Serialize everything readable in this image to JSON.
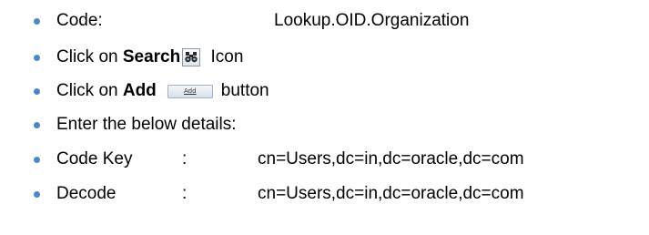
{
  "colors": {
    "bullet": "#4a86c8",
    "text": "#000000",
    "background": "#ffffff"
  },
  "items": [
    {
      "label": "Code:",
      "value": "Lookup.OID.Organization"
    },
    {
      "prefix": "Click on ",
      "bold": "Search",
      "icon": "binoculars-search-icon",
      "suffix": " Icon"
    },
    {
      "prefix": "Click on ",
      "bold": "Add",
      "button_label": "Add",
      "suffix": "button"
    },
    {
      "text": "Enter the below details:"
    },
    {
      "label": "Code Key",
      "colon": ":",
      "value": "cn=Users,dc=in,dc=oracle,dc=com"
    },
    {
      "label": "Decode",
      "colon": ":",
      "value": "cn=Users,dc=in,dc=oracle,dc=com"
    }
  ]
}
